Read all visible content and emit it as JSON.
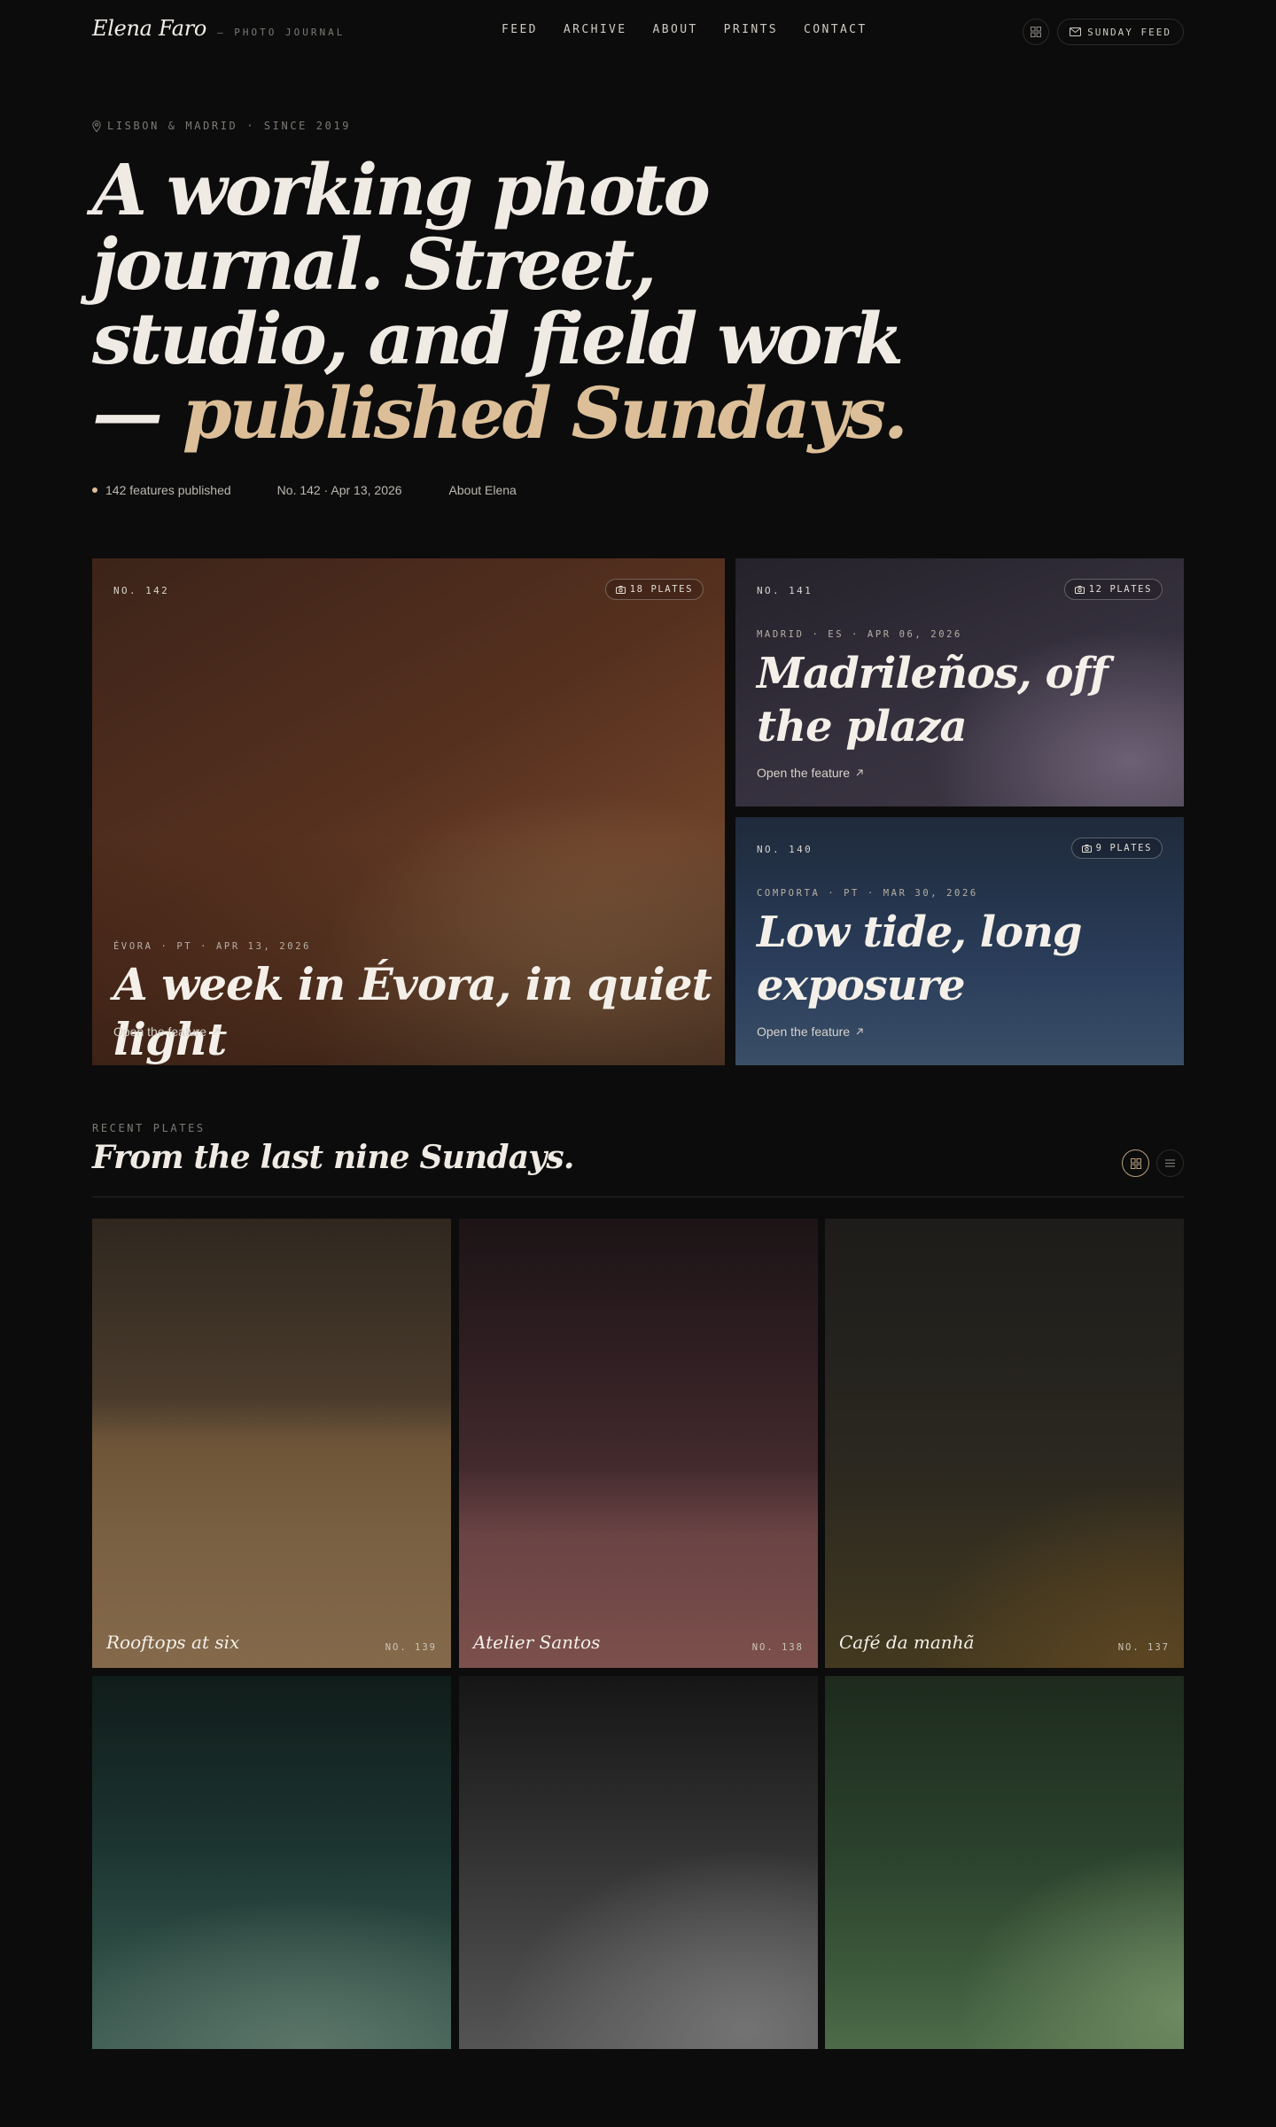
{
  "brand": {
    "name": "Elena Faro",
    "tagline": "— PHOTO JOURNAL"
  },
  "nav": [
    "FEED",
    "ARCHIVE",
    "ABOUT",
    "PRINTS",
    "CONTACT"
  ],
  "header": {
    "grid_icon": "grid-icon",
    "feed_button": "SUNDAY FEED",
    "feed_icon": "mail-icon"
  },
  "hero": {
    "kicker": "LISBON & MADRID · SINCE 2019",
    "kicker_icon": "pin-icon",
    "headline_lead": "A working photo journal. Street, studio, and field work — ",
    "headline_accent": "published Sundays.",
    "meta": {
      "published": "142 features published",
      "latest": "No. 142 · Apr 13, 2026",
      "about": "About Elena"
    }
  },
  "features": [
    {
      "no": "NO. 142",
      "plates": "18 PLATES",
      "location": "ÉVORA · PT · APR 13, 2026",
      "title": "A week in Évora, in quiet light",
      "link": "Open the feature"
    },
    {
      "no": "NO. 141",
      "plates": "12 PLATES",
      "location": "MADRID · ES · APR 06, 2026",
      "title": "Madrileños, off the plaza",
      "link": "Open the feature"
    },
    {
      "no": "NO. 140",
      "plates": "9 PLATES",
      "location": "COMPORTA · PT · MAR 30, 2026",
      "title": "Low tide, long exposure",
      "link": "Open the feature"
    }
  ],
  "recent": {
    "kicker": "RECENT PLATES",
    "title": "From the last nine Sundays.",
    "view_icons": [
      "grid-view-icon",
      "list-view-icon"
    ],
    "plates": [
      {
        "title": "Rooftops at six",
        "no": "NO. 139"
      },
      {
        "title": "Atelier Santos",
        "no": "NO. 138"
      },
      {
        "title": "Café da manhã",
        "no": "NO. 137"
      },
      {
        "title": "",
        "no": ""
      },
      {
        "title": "",
        "no": ""
      },
      {
        "title": "",
        "no": ""
      }
    ]
  },
  "colors": {
    "background": "#0c0c0c",
    "accent": "#dcbf98",
    "text": "#efebe4"
  }
}
